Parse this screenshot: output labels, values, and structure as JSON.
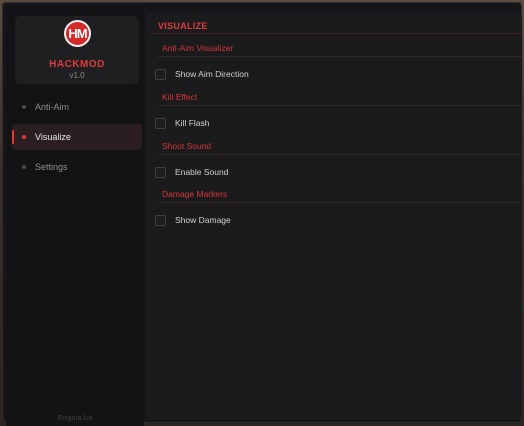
{
  "app": {
    "logo_letters": "HM",
    "name": "HACKMOD",
    "version": "v1.0",
    "footer": "Enigma.lua"
  },
  "sidebar": {
    "items": [
      {
        "label": "Anti-Aim",
        "active": false
      },
      {
        "label": "Visualize",
        "active": true
      },
      {
        "label": "Settings",
        "active": false
      }
    ]
  },
  "main": {
    "title": "VISUALIZE",
    "sections": [
      {
        "header": "Anti-Aim Visualizer",
        "option": "Show Aim Direction",
        "checked": false
      },
      {
        "header": "Kill Effect",
        "option": "Kill Flash",
        "checked": false
      },
      {
        "header": "Shoot Sound",
        "option": "Enable Sound",
        "checked": false
      },
      {
        "header": "Damage Markers",
        "option": "Show Damage",
        "checked": false
      }
    ]
  },
  "colors": {
    "accent": "#e03a3a",
    "window_bg": "#161618",
    "panel_bg": "#1b1b1e"
  }
}
